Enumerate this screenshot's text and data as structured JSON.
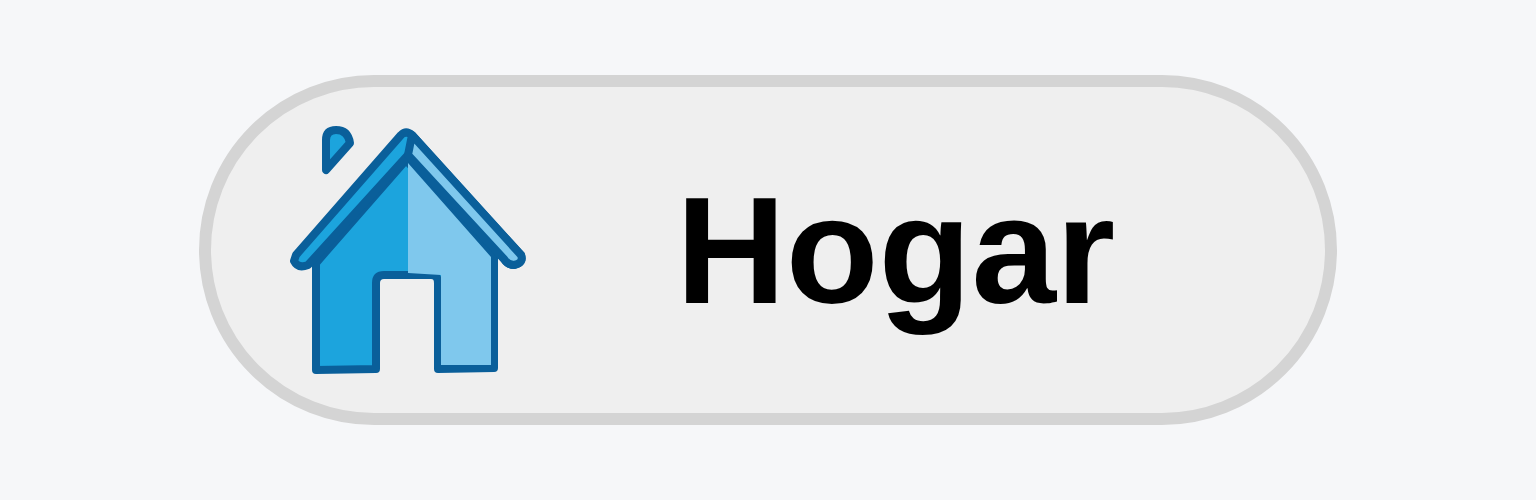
{
  "button": {
    "label": "Hogar"
  }
}
